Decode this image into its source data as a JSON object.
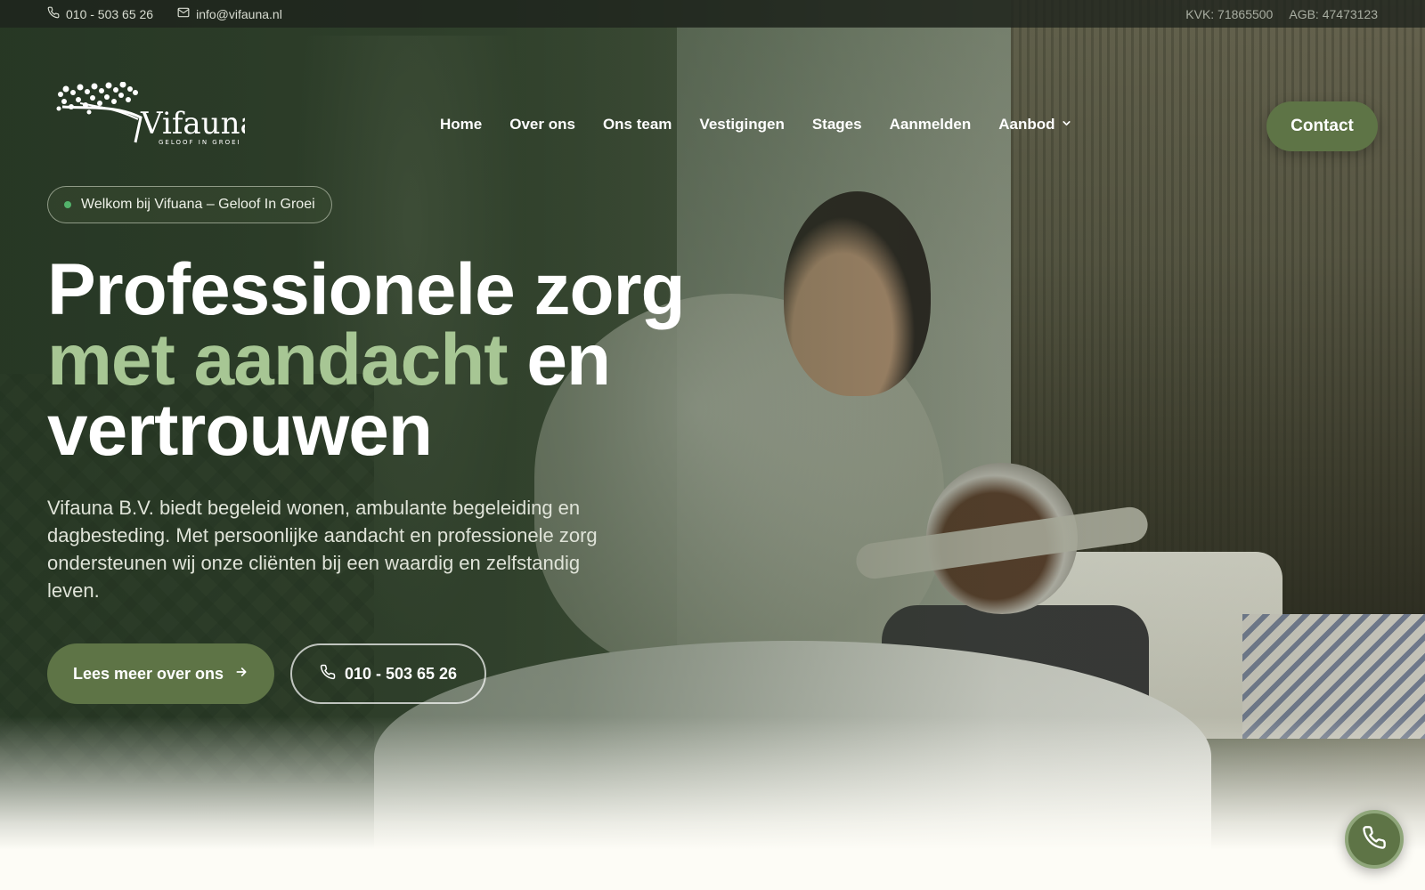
{
  "topbar": {
    "phone": "010 - 503 65 26",
    "email": "info@vifauna.nl",
    "kvk": "KVK: 71865500",
    "agb": "AGB: 47473123",
    "icons": [
      "phone-icon",
      "mail-icon"
    ]
  },
  "logo": {
    "name": "Vifauna",
    "tagline": "GELOOF IN GROEI"
  },
  "nav": {
    "items": [
      {
        "label": "Home"
      },
      {
        "label": "Over ons"
      },
      {
        "label": "Ons team"
      },
      {
        "label": "Vestigingen"
      },
      {
        "label": "Stages"
      },
      {
        "label": "Aanmelden"
      },
      {
        "label": "Aanbod",
        "icon": "chevron-down-icon"
      }
    ],
    "contact_label": "Contact"
  },
  "hero": {
    "badge": "Welkom bij Vifuana – Geloof In Groei",
    "headline_line1": "Professionele zorg",
    "headline_accent": "met aandacht",
    "headline_after_accent": " en",
    "headline_line3": "vertrouwen",
    "lead": "Vifauna B.V. biedt begeleid wonen, ambulante begeleiding en dagbesteding. Met persoonlijke aandacht en professionele zorg ondersteunen wij onze cliënten bij een waardig en zelfstandig leven.",
    "primary_button": "Lees meer over ons",
    "secondary_button": "010 - 503 65 26"
  },
  "colors": {
    "brand_green": "#5e7446",
    "accent_text": "#a7c694",
    "badge_dot": "#53b36b",
    "page_bg": "#fdfcf6"
  },
  "floating_button": {
    "icon": "phone-icon"
  }
}
